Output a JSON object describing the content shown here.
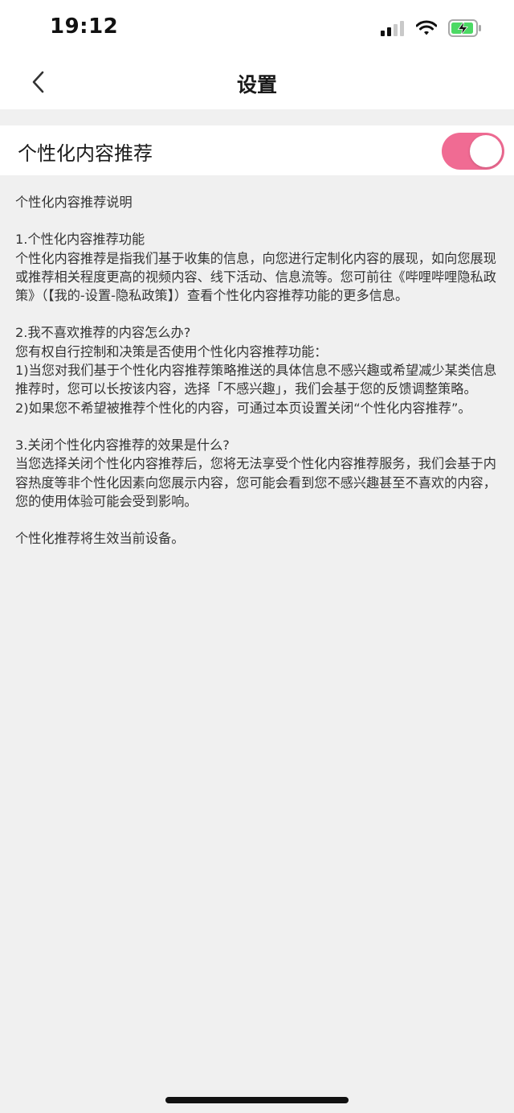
{
  "status_bar": {
    "time": "19:12",
    "icons": [
      "cellular-signal-icon",
      "wifi-icon",
      "battery-charging-icon"
    ],
    "battery_color": "#4cd964"
  },
  "nav": {
    "title": "设置",
    "back_icon": "chevron-left-icon"
  },
  "setting": {
    "label": "个性化内容推荐",
    "enabled": true,
    "accent_color": "#f06b93"
  },
  "description": {
    "heading": "个性化内容推荐说明",
    "section1_title": "1.个性化内容推荐功能",
    "section1_body": "个性化内容推荐是指我们基于收集的信息，向您进行定制化内容的展现，如向您展现或推荐相关程度更高的视频内容、线下活动、信息流等。您可前往《哔哩哔哩隐私政策》（【我的-设置-隐私政策】）查看个性化内容推荐功能的更多信息。",
    "section2_title": "2.我不喜欢推荐的内容怎么办?",
    "section2_intro": "您有权自行控制和决策是否使用个性化内容推荐功能：",
    "section2_item1": "1)当您对我们基于个性化内容推荐策略推送的具体信息不感兴趣或希望减少某类信息推荐时，您可以长按该内容，选择「不感兴趣」，我们会基于您的反馈调整策略。",
    "section2_item2": "2)如果您不希望被推荐个性化的内容，可通过本页设置关闭“个性化内容推荐”。",
    "section3_title": "3.关闭个性化内容推荐的效果是什么?",
    "section3_body": "当您选择关闭个性化内容推荐后，您将无法享受个性化内容推荐服务，我们会基于内容热度等非个性化因素向您展示内容，您可能会看到您不感兴趣甚至不喜欢的内容，您的使用体验可能会受到影响。",
    "footer": "个性化推荐将生效当前设备。"
  }
}
